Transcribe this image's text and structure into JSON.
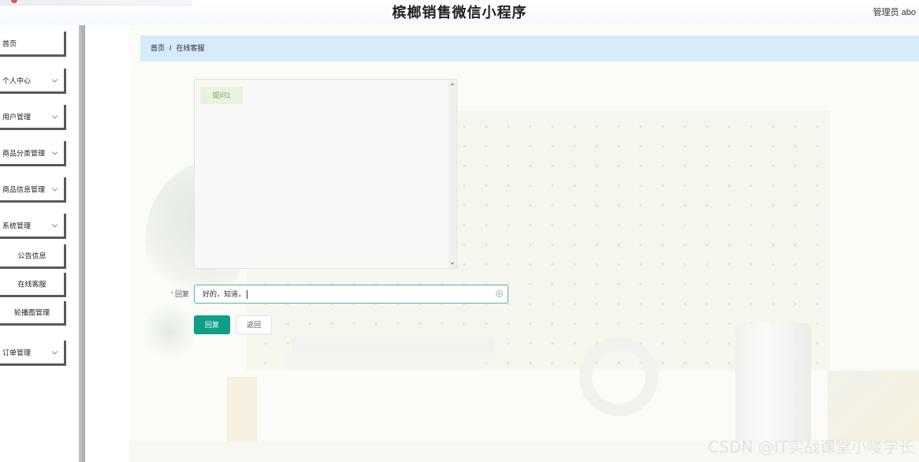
{
  "header": {
    "title": "槟榔销售微信小程序",
    "user": "管理员 abo"
  },
  "sidebar": {
    "items": [
      {
        "label": "首页",
        "has_arrow": false
      },
      {
        "label": "个人中心",
        "has_arrow": true
      },
      {
        "label": "用户管理",
        "has_arrow": true
      },
      {
        "label": "商品分类管理",
        "has_arrow": true
      },
      {
        "label": "商品信息管理",
        "has_arrow": true
      },
      {
        "label": "系统管理",
        "has_arrow": true
      }
    ],
    "sub_items": [
      "公告信息",
      "在线客服",
      "轮播图管理"
    ],
    "last_item": {
      "label": "订单管理",
      "has_arrow": true
    }
  },
  "breadcrumb": {
    "home": "首页",
    "separator": "/",
    "current": "在线客服"
  },
  "chat": {
    "messages": [
      "提问1"
    ]
  },
  "form": {
    "reply_label": "回复",
    "required_mark": "*",
    "reply_value": "好的，知道，",
    "reply_button": "回复",
    "back_button": "返回"
  },
  "watermark": "CSDN @IT实战课堂小喽学长",
  "colors": {
    "primary_button": "#0d9f88",
    "breadcrumb_bg": "#d6ecfa",
    "input_border": "#52b7b0"
  }
}
